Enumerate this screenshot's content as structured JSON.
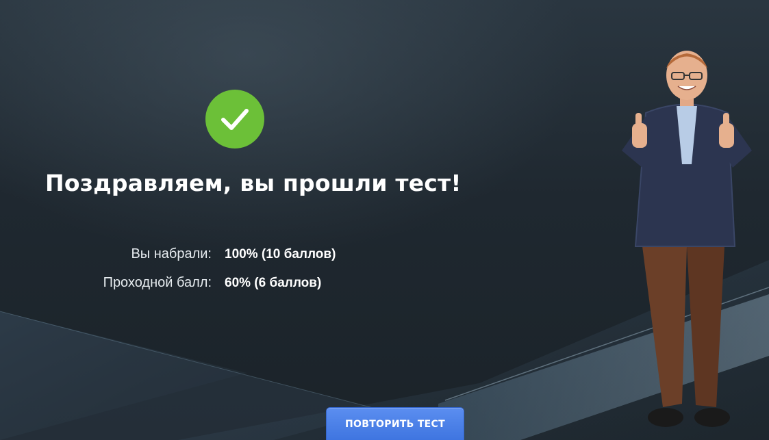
{
  "result": {
    "headline": "Поздравляем, вы прошли тест!",
    "status_icon": "check-icon",
    "status_color": "#6cc038"
  },
  "score": {
    "earned_label": "Вы набрали:",
    "earned_value": "100% (10 баллов)",
    "passing_label": "Проходной балл:",
    "passing_value": "60% (6 баллов)"
  },
  "actions": {
    "retry_label": "ПОВТОРИТЬ ТЕСТ",
    "retry_color": "#4a80ea"
  },
  "presenter": {
    "description": "presenter-thumbs-up-image"
  }
}
